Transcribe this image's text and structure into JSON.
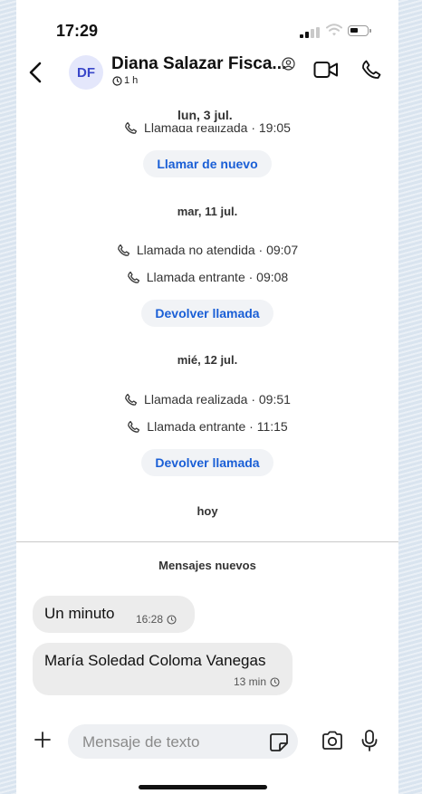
{
  "status_bar": {
    "time": "17:29"
  },
  "header": {
    "avatar_initials": "DF",
    "contact_name": "Diana Salazar Fisca...",
    "timer_label": "1 h"
  },
  "conversation": {
    "sticky_date": "lun, 3 jul.",
    "top_event": "Llamada realizada · 19:05",
    "top_action": "Llamar de nuevo",
    "day2": {
      "date": "mar, 11 jul.",
      "events": [
        "Llamada no atendida · 09:07",
        "Llamada entrante · 09:08"
      ],
      "action": "Devolver llamada"
    },
    "day3": {
      "date": "mié, 12 jul.",
      "events": [
        "Llamada realizada · 09:51",
        "Llamada entrante · 11:15"
      ],
      "action": "Devolver llamada"
    },
    "today_label": "hoy",
    "new_messages_label": "Mensajes nuevos",
    "messages": [
      {
        "text": "Un minuto",
        "time": "16:28"
      },
      {
        "text": "María Soledad Coloma Vanegas",
        "time": "13 min"
      }
    ]
  },
  "composer": {
    "placeholder": "Mensaje de texto"
  },
  "colors": {
    "accent": "#1a5fd6",
    "avatar_bg": "#e4e7fb",
    "bubble": "#ececec"
  }
}
